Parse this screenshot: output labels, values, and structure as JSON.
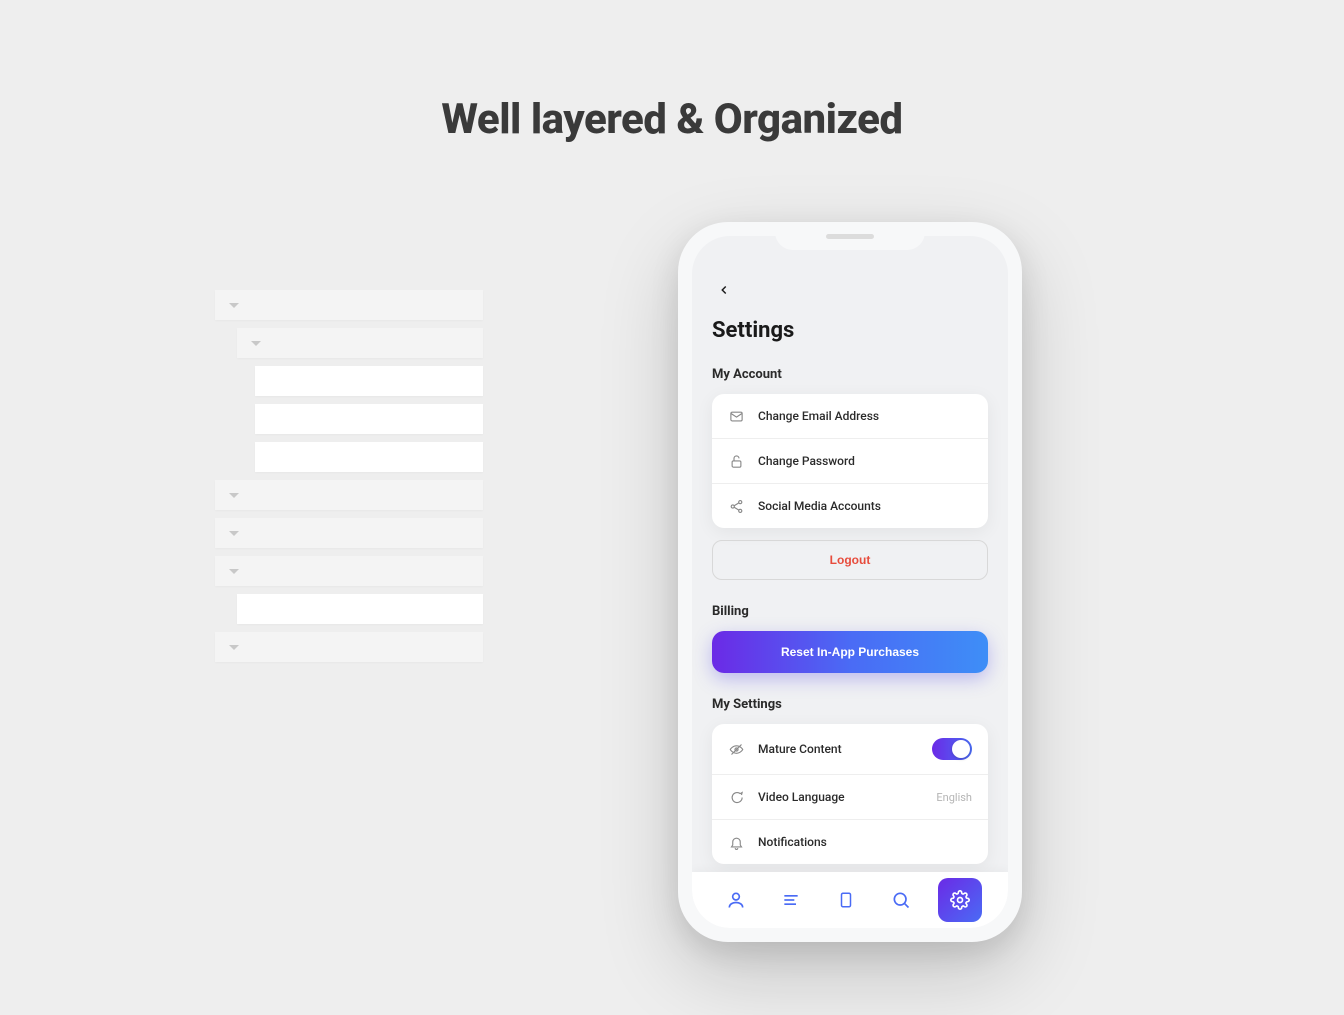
{
  "heading": "Well layered & Organized",
  "phone": {
    "screen_title": "Settings",
    "sections": {
      "account": {
        "label": "My Account",
        "items": [
          {
            "label": "Change Email Address",
            "icon": "mail-icon"
          },
          {
            "label": "Change Password",
            "icon": "lock-icon"
          },
          {
            "label": "Social Media Accounts",
            "icon": "share-icon"
          }
        ],
        "logout_label": "Logout"
      },
      "billing": {
        "label": "Billing",
        "reset_label": "Reset In-App Purchases"
      },
      "settings": {
        "label": "My Settings",
        "items": [
          {
            "label": "Mature Content",
            "icon": "eye-off-icon",
            "toggle_on": true
          },
          {
            "label": "Video Language",
            "icon": "chat-icon",
            "value": "English"
          },
          {
            "label": "Notifications",
            "icon": "bell-icon"
          }
        ]
      }
    },
    "tabs": [
      "profile",
      "feed",
      "bookmark",
      "search",
      "settings"
    ]
  }
}
